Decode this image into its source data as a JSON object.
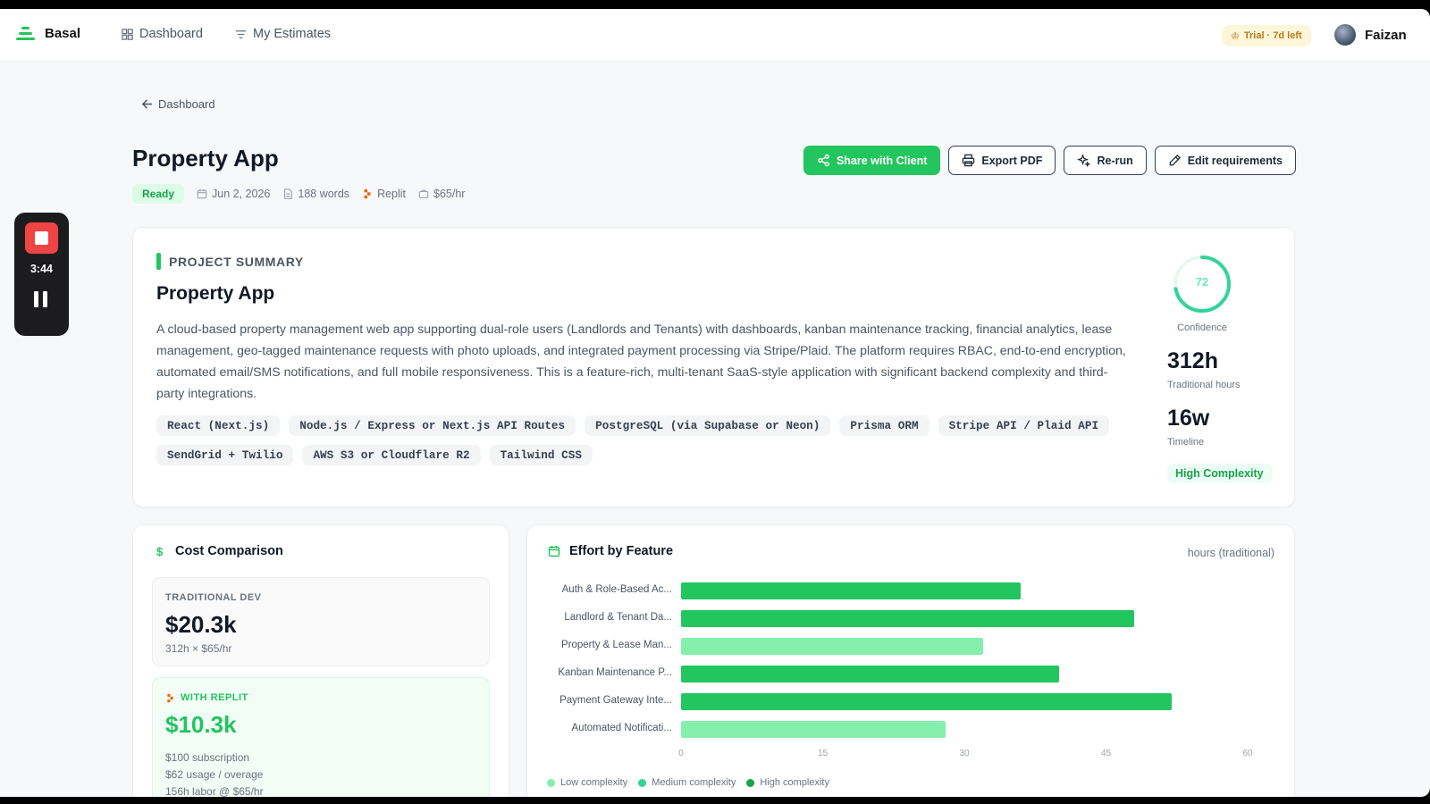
{
  "nav": {
    "brand": "Basal",
    "links": [
      "Dashboard",
      "My Estimates"
    ],
    "trial_badge": "Trial · 7d left",
    "user_name": "Faizan"
  },
  "breadcrumb": "Dashboard",
  "header": {
    "title": "Property App",
    "status": "Ready",
    "date": "Jun 2, 2026",
    "words": "188 words",
    "platform": "Replit",
    "rate": "$65/hr"
  },
  "actions": {
    "share": "Share with Client",
    "export": "Export PDF",
    "rerun": "Re-run",
    "edit": "Edit requirements"
  },
  "recorder": {
    "time": "3:44"
  },
  "summary": {
    "section_label": "PROJECT SUMMARY",
    "title": "Property App",
    "description": "A cloud-based property management web app supporting dual-role users (Landlords and Tenants) with dashboards, kanban maintenance tracking, financial analytics, lease management, geo-tagged maintenance requests with photo uploads, and integrated payment processing via Stripe/Plaid. The platform requires RBAC, end-to-end encryption, automated email/SMS notifications, and full mobile responsiveness. This is a feature-rich, multi-tenant SaaS-style application with significant backend complexity and third-party integrations.",
    "tags": [
      "React (Next.js)",
      "Node.js / Express or Next.js API Routes",
      "PostgreSQL (via Supabase or Neon)",
      "Prisma ORM",
      "Stripe API / Plaid API",
      "SendGrid + Twilio",
      "AWS S3 or Cloudflare R2",
      "Tailwind CSS"
    ],
    "confidence": {
      "value": "72",
      "fraction": 0.72,
      "label": "Confidence"
    },
    "hours": {
      "value": "312h",
      "label": "Traditional hours"
    },
    "timeline": {
      "value": "16w",
      "label": "Timeline"
    },
    "complexity": "High Complexity"
  },
  "cost": {
    "title": "Cost Comparison",
    "traditional": {
      "label": "TRADITIONAL DEV",
      "amount": "$20.3k",
      "detail": "312h × $65/hr"
    },
    "replit": {
      "label": "WITH REPLIT",
      "amount": "$10.3k",
      "lines": [
        "$100 subscription",
        "$62 usage / overage",
        "156h labor @ $65/hr"
      ]
    }
  },
  "effort": {
    "title": "Effort by Feature",
    "unit": "hours (traditional)",
    "legend": [
      "Low complexity",
      "Medium complexity",
      "High complexity"
    ]
  },
  "colors": {
    "accent": "#22c55e",
    "high": "#22c55e",
    "medium": "#34d399",
    "low": "#86efac"
  },
  "chart_data": {
    "type": "bar",
    "orientation": "horizontal",
    "categories": [
      "Auth & Role-Based Ac...",
      "Landlord & Tenant Da...",
      "Property & Lease Man...",
      "Kanban Maintenance P...",
      "Payment Gateway Inte...",
      "Automated Notificati..."
    ],
    "values": [
      36,
      48,
      32,
      40,
      52,
      28
    ],
    "complexity": [
      "high",
      "high",
      "low",
      "high",
      "high",
      "low"
    ],
    "xticks": [
      0,
      15,
      30,
      45,
      60
    ],
    "xlim": [
      0,
      60
    ],
    "xlabel": "",
    "ylabel": "",
    "legend_position": "bottom-left"
  }
}
